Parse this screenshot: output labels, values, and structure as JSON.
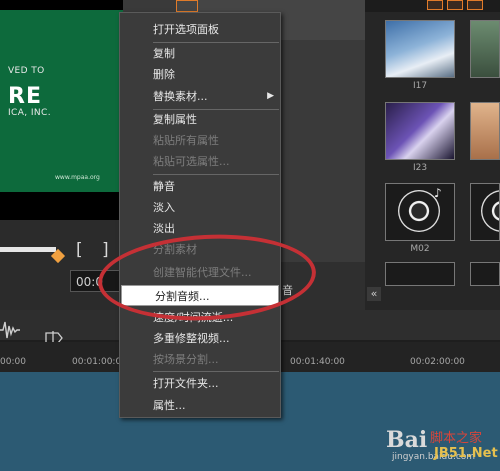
{
  "preview": {
    "rating_line1": "VED TO",
    "rating_line2": "RE",
    "rating_line3": "ICA, INC.",
    "rating_url": "www.mpaa.org",
    "bracket_in": "[",
    "bracket_out": "]",
    "timecode": "00:0"
  },
  "library": {
    "labels": [
      "I17",
      "I23",
      "M02"
    ],
    "collapse_icon": "«"
  },
  "middle": {
    "fragment": "音"
  },
  "context_menu": {
    "items": [
      {
        "label": "打开选项面板",
        "enabled": true
      },
      {
        "label": "复制",
        "enabled": true
      },
      {
        "label": "删除",
        "enabled": true
      },
      {
        "label": "替换素材...",
        "enabled": true,
        "submenu": true
      },
      {
        "label": "复制属性",
        "enabled": true
      },
      {
        "label": "粘贴所有属性",
        "enabled": false
      },
      {
        "label": "粘贴可选属性...",
        "enabled": false
      },
      {
        "label": "静音",
        "enabled": true
      },
      {
        "label": "淡入",
        "enabled": true
      },
      {
        "label": "淡出",
        "enabled": true
      },
      {
        "label": "分割素材",
        "enabled": false
      },
      {
        "label": "创建智能代理文件...",
        "enabled": false
      },
      {
        "label": "分割音频...",
        "enabled": true,
        "highlighted": true
      },
      {
        "label": "速度/时间流逝...",
        "enabled": true
      },
      {
        "label": "多重修整视频...",
        "enabled": true
      },
      {
        "label": "按场景分割...",
        "enabled": false
      },
      {
        "label": "打开文件夹...",
        "enabled": true
      },
      {
        "label": "属性...",
        "enabled": true
      }
    ],
    "submenu_arrow": "▶"
  },
  "timeline": {
    "ruler_labels": [
      "00:00",
      "00:01:00:00",
      "00:01:40:00",
      "00:02:00:00"
    ]
  },
  "watermark": {
    "baidu": "Bai",
    "brand_cn": "脚本之家",
    "site": "jingyan.baidu.com",
    "jb51": "JB51.Net"
  },
  "colors": {
    "highlight_circle": "#c53035",
    "accent_orange": "#e07b2a"
  }
}
